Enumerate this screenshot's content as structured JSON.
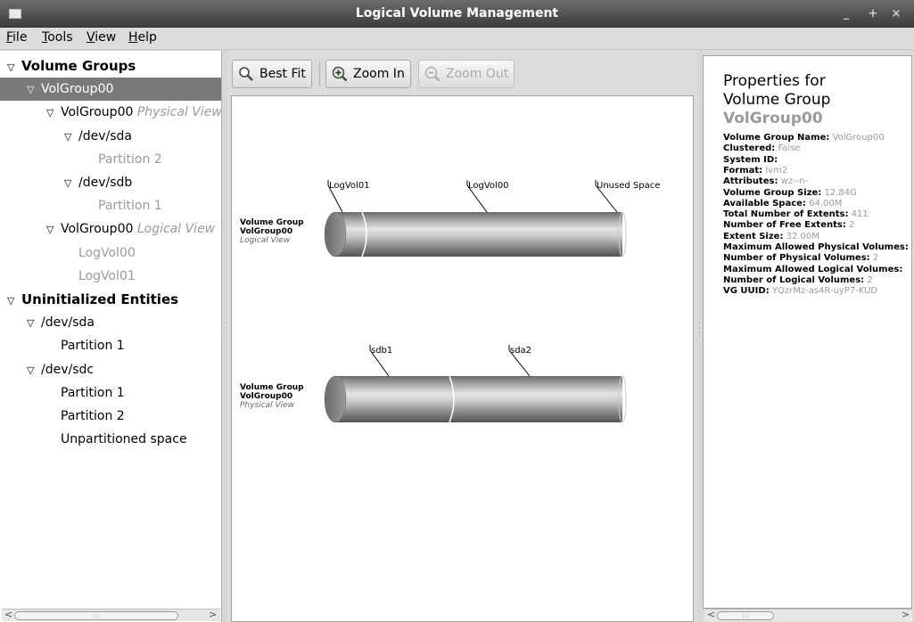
{
  "window": {
    "title": "Logical Volume Management"
  },
  "menu": [
    "File",
    "Tools",
    "View",
    "Help"
  ],
  "tree": [
    {
      "text": "Volume Groups",
      "style": "bold",
      "arrow": true,
      "indent": 0
    },
    {
      "text": "VolGroup00",
      "style": "selected",
      "arrow": true,
      "indent": 1
    },
    {
      "text": "VolGroup00",
      "extra": "Physical View",
      "style": "normal",
      "arrow": true,
      "indent": 2
    },
    {
      "text": "/dev/sda",
      "style": "normal",
      "arrow": true,
      "indent": 3
    },
    {
      "text": "Partition 2",
      "style": "gray",
      "arrow": false,
      "indent": 4
    },
    {
      "text": "/dev/sdb",
      "style": "normal",
      "arrow": true,
      "indent": 3
    },
    {
      "text": "Partition 1",
      "style": "gray",
      "arrow": false,
      "indent": 4
    },
    {
      "text": "VolGroup00",
      "extra": "Logical View",
      "style": "normal",
      "arrow": true,
      "indent": 2
    },
    {
      "text": "LogVol00",
      "style": "gray",
      "arrow": false,
      "indent": 3
    },
    {
      "text": "LogVol01",
      "style": "gray",
      "arrow": false,
      "indent": 3
    },
    {
      "text": "Uninitialized Entities",
      "style": "bold",
      "arrow": true,
      "indent": 0
    },
    {
      "text": "/dev/sda",
      "style": "normal",
      "arrow": true,
      "indent": 1
    },
    {
      "text": "Partition 1",
      "style": "normal",
      "arrow": false,
      "indent": 2
    },
    {
      "text": "/dev/sdc",
      "style": "normal",
      "arrow": true,
      "indent": 1
    },
    {
      "text": "Partition 1",
      "style": "normal",
      "arrow": false,
      "indent": 2
    },
    {
      "text": "Partition 2",
      "style": "normal",
      "arrow": false,
      "indent": 2
    },
    {
      "text": "Unpartitioned space",
      "style": "normal",
      "arrow": false,
      "indent": 2
    }
  ],
  "toolbar": {
    "best_fit": "Best Fit",
    "zoom_in": "Zoom In",
    "zoom_out": "Zoom Out"
  },
  "logical_view": {
    "line1": "Volume Group",
    "line2": "VolGroup00",
    "line3": "Logical View",
    "segments": [
      "LogVol01",
      "LogVol00",
      "Unused Space"
    ]
  },
  "physical_view": {
    "line1": "Volume Group",
    "line2": "VolGroup00",
    "line3": "Physical View",
    "segments": [
      "sdb1",
      "sda2"
    ]
  },
  "properties": {
    "heading_line1": "Properties for",
    "heading_line2": "Volume Group",
    "name": "VolGroup00",
    "rows": [
      {
        "k": "Volume Group Name:",
        "v": "VolGroup00"
      },
      {
        "k": "Clustered:",
        "v": "False"
      },
      {
        "k": "System ID:",
        "v": ""
      },
      {
        "k": "Format:",
        "v": "lvm2"
      },
      {
        "k": "Attributes:",
        "v": "wz--n-"
      },
      {
        "k": "Volume Group Size:",
        "v": "12.84G"
      },
      {
        "k": "Available Space:",
        "v": "64.00M"
      },
      {
        "k": "Total Number of Extents:",
        "v": "411"
      },
      {
        "k": "Number of Free Extents:",
        "v": "2"
      },
      {
        "k": "Extent Size:",
        "v": "32.00M"
      },
      {
        "k": "Maximum Allowed Physical Volumes:",
        "v": ""
      },
      {
        "k": "Number of Physical Volumes:",
        "v": "2"
      },
      {
        "k": "Maximum Allowed Logical Volumes:",
        "v": ""
      },
      {
        "k": "Number of Logical Volumes:",
        "v": "2"
      },
      {
        "k": "VG UUID:",
        "v": "YQzrMz-as4R-uyP7-KUD"
      }
    ]
  },
  "icons": {
    "window_menu": "window-menu-icon",
    "minimize": "minimize-icon",
    "maximize": "maximize-icon",
    "close": "close-icon",
    "best_fit": "magnifier-icon",
    "zoom_in": "zoom-in-icon",
    "zoom_out": "zoom-out-icon"
  }
}
